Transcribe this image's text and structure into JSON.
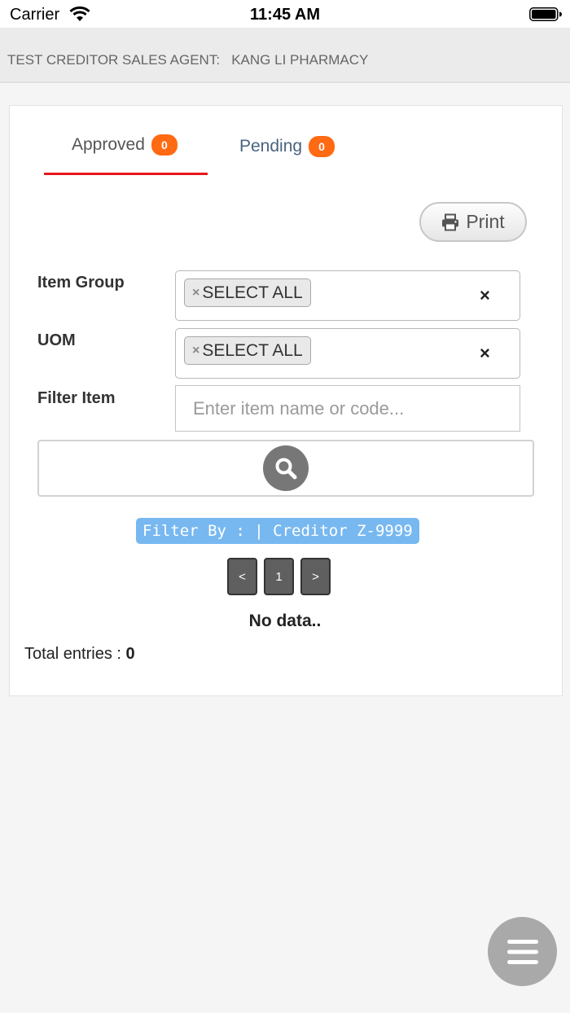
{
  "status_bar": {
    "carrier": "Carrier",
    "time": "11:45 AM"
  },
  "header": {
    "title": "TEST CREDITOR SALES AGENT:   KANG LI PHARMACY"
  },
  "tabs": [
    {
      "label": "Approved",
      "count": "0",
      "active": true
    },
    {
      "label": "Pending",
      "count": "0",
      "active": false
    }
  ],
  "toolbar": {
    "print_label": "Print",
    "print_icon": "printer-icon"
  },
  "filters": {
    "item_group": {
      "label": "Item Group",
      "chip_label": "SELECT ALL",
      "chip_remove": "×",
      "clear": "×"
    },
    "uom": {
      "label": "UOM",
      "chip_label": "SELECT ALL",
      "chip_remove": "×",
      "clear": "×"
    },
    "filter_item": {
      "label": "Filter Item",
      "placeholder": "Enter item name or code...",
      "value": ""
    },
    "search_icon": "search-icon"
  },
  "filter_summary": "Filter By : | Creditor Z-9999",
  "pagination": {
    "prev": "<",
    "current": "1",
    "next": ">"
  },
  "results": {
    "empty_message": "No data..",
    "total_label": "Total entries :",
    "total_value": "0"
  },
  "fab": {
    "icon": "menu-icon"
  },
  "colors": {
    "accent_badge": "#ff6a13",
    "tab_underline": "#e8171b",
    "filter_chip_bg": "#78b8f0"
  }
}
